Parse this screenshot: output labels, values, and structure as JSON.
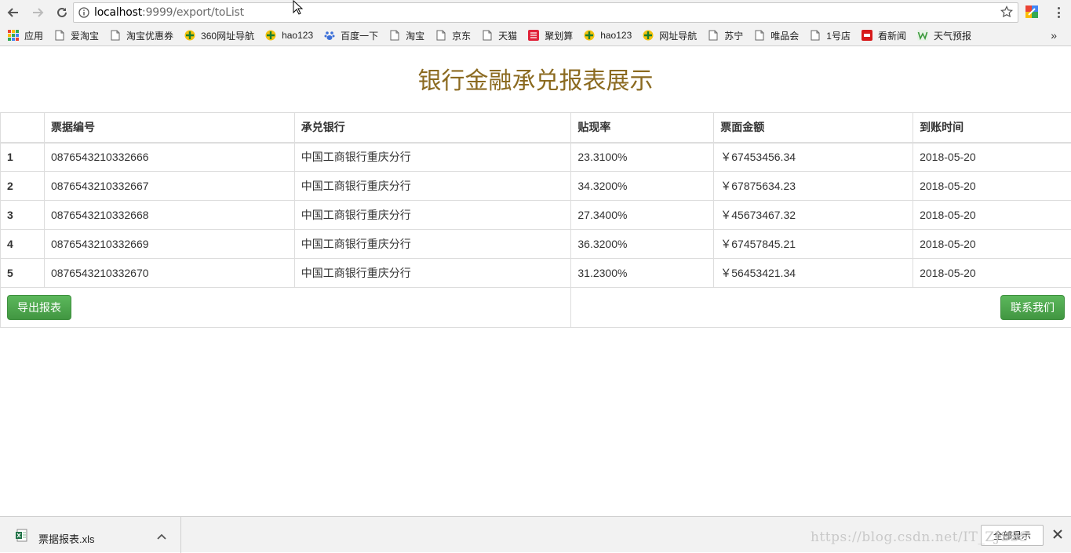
{
  "browser": {
    "url_host": "localhost",
    "url_path": ":9999/export/toList"
  },
  "bookmarks": {
    "items": [
      {
        "label": "应用",
        "icon": "apps-grid-icon"
      },
      {
        "label": "爱淘宝",
        "icon": "page-icon"
      },
      {
        "label": "淘宝优惠券",
        "icon": "page-icon"
      },
      {
        "label": "360网址导航",
        "icon": "360-icon"
      },
      {
        "label": "hao123",
        "icon": "360-icon"
      },
      {
        "label": "百度一下",
        "icon": "baidu-paw-icon"
      },
      {
        "label": "淘宝",
        "icon": "page-icon"
      },
      {
        "label": "京东",
        "icon": "page-icon"
      },
      {
        "label": "天猫",
        "icon": "page-icon"
      },
      {
        "label": "聚划算",
        "icon": "juhuasuan-icon"
      },
      {
        "label": "hao123",
        "icon": "360-icon"
      },
      {
        "label": "网址导航",
        "icon": "360-icon"
      },
      {
        "label": "苏宁",
        "icon": "page-icon"
      },
      {
        "label": "唯品会",
        "icon": "page-icon"
      },
      {
        "label": "1号店",
        "icon": "page-icon"
      },
      {
        "label": "看新闻",
        "icon": "news-icon"
      },
      {
        "label": "天气预报",
        "icon": "weather-icon"
      }
    ],
    "more": "»"
  },
  "page": {
    "title": "银行金融承兑报表展示"
  },
  "table": {
    "headers": [
      "",
      "票据编号",
      "承兑银行",
      "贴现率",
      "票面金额",
      "到账时间"
    ],
    "rows": [
      [
        "1",
        "0876543210332666",
        "中国工商银行重庆分行",
        "23.3100%",
        "￥67453456.34",
        "2018-05-20"
      ],
      [
        "2",
        "0876543210332667",
        "中国工商银行重庆分行",
        "34.3200%",
        "￥67875634.23",
        "2018-05-20"
      ],
      [
        "3",
        "0876543210332668",
        "中国工商银行重庆分行",
        "27.3400%",
        "￥45673467.32",
        "2018-05-20"
      ],
      [
        "4",
        "0876543210332669",
        "中国工商银行重庆分行",
        "36.3200%",
        "￥67457845.21",
        "2018-05-20"
      ],
      [
        "5",
        "0876543210332670",
        "中国工商银行重庆分行",
        "31.2300%",
        "￥56453421.34",
        "2018-05-20"
      ]
    ],
    "export_button": "导出报表",
    "contact_button": "联系我们"
  },
  "download_shelf": {
    "file_name": "票据报表.xls",
    "show_all": "全部显示"
  },
  "watermark": "https://blog.csdn.net/IT_ZJSSS",
  "colors": {
    "title": "#8b6a20",
    "button_green": "#5cb85c"
  }
}
